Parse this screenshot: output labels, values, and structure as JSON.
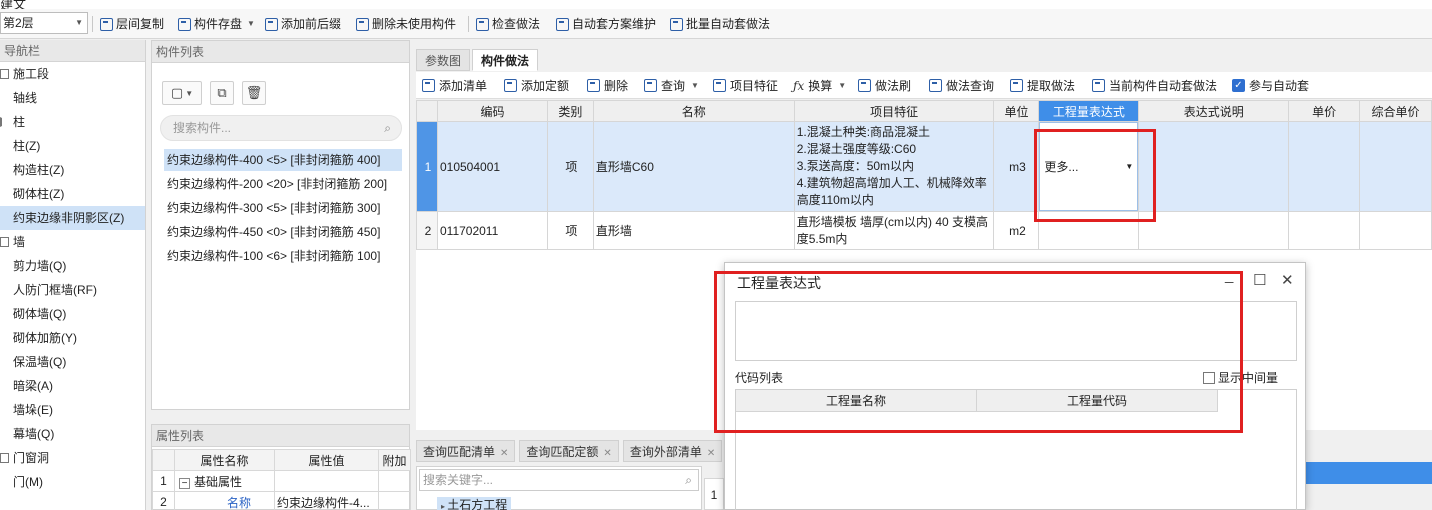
{
  "top_strip_text": "建文",
  "toolbar": {
    "floor": "第2层",
    "buttons": [
      "层间复制",
      "构件存盘",
      "添加前后缀",
      "删除未使用构件",
      "检查做法",
      "自动套方案维护",
      "批量自动套做法"
    ]
  },
  "nav": {
    "title": "导航栏",
    "items": [
      {
        "label": "施工段",
        "group": true
      },
      {
        "label": "轴线",
        "group": true
      },
      {
        "label": "柱",
        "group": true
      },
      {
        "label": "柱(Z)",
        "group": false
      },
      {
        "label": "构造柱(Z)",
        "group": false
      },
      {
        "label": "砌体柱(Z)",
        "group": false
      },
      {
        "label": "约束边缘非阴影区(Z)",
        "group": false,
        "selected": true
      },
      {
        "label": "墙",
        "group": true
      },
      {
        "label": "剪力墙(Q)",
        "group": false
      },
      {
        "label": "人防门框墙(RF)",
        "group": false
      },
      {
        "label": "砌体墙(Q)",
        "group": false
      },
      {
        "label": "砌体加筋(Y)",
        "group": false
      },
      {
        "label": "保温墙(Q)",
        "group": false
      },
      {
        "label": "暗梁(A)",
        "group": false
      },
      {
        "label": "墙垛(E)",
        "group": false
      },
      {
        "label": "幕墙(Q)",
        "group": false
      },
      {
        "label": "门窗洞",
        "group": true
      },
      {
        "label": "门(M)",
        "group": false
      }
    ]
  },
  "component_list": {
    "title": "构件列表",
    "search_placeholder": "搜索构件...",
    "items": [
      "约束边缘构件-400 <5> [非封闭箍筋 400]",
      "约束边缘构件-200 <20> [非封闭箍筋 200]",
      "约束边缘构件-300 <5> [非封闭箍筋 300]",
      "约束边缘构件-450 <0> [非封闭箍筋 450]",
      "约束边缘构件-100 <6> [非封闭箍筋 100]"
    ]
  },
  "property_list": {
    "title": "属性列表",
    "headers": [
      "属性名称",
      "属性值",
      "附加"
    ],
    "rows": [
      {
        "idx": "1",
        "name": "基础属性",
        "value": "",
        "toggle": "−"
      },
      {
        "idx": "2",
        "name": "名称",
        "value": "约束边缘构件-4..."
      }
    ]
  },
  "tabs": [
    "参数图",
    "构件做法"
  ],
  "method_toolbar": {
    "buttons": [
      "添加清单",
      "添加定额",
      "删除",
      "查询",
      "项目特征",
      "换算",
      "做法刷",
      "做法查询",
      "提取做法",
      "当前构件自动套做法"
    ],
    "checkbox_label": "参与自动套"
  },
  "grid": {
    "headers": [
      "编码",
      "类别",
      "名称",
      "项目特征",
      "单位",
      "工程量表达式",
      "表达式说明",
      "单价",
      "综合单价"
    ],
    "rows": [
      {
        "idx": "1",
        "code": "010504001",
        "type": "项",
        "name": "直形墙C60",
        "features": [
          "1.混凝土种类:商品混凝土",
          "2.混凝土强度等级:C60",
          "3.泵送高度：50m以内",
          "4.建筑物超高增加人工、机械降效率高度110m以内"
        ],
        "unit": "m3",
        "expression": "更多..."
      },
      {
        "idx": "2",
        "code": "011702011",
        "type": "项",
        "name": "直形墙",
        "features": [
          "直形墙模板 墙厚(cm以内) 40 支模高度5.5m内"
        ],
        "unit": "m2",
        "expression": ""
      }
    ]
  },
  "lower_tabs": [
    "查询匹配清单",
    "查询匹配定额",
    "查询外部清单"
  ],
  "lower_search_placeholder": "搜索关键字...",
  "lower_tree_item": "土石方工程",
  "lower_row_idx": "1",
  "dialog": {
    "title": "工程量表达式",
    "code_list_label": "代码列表",
    "show_mid_label": "显示中间量",
    "columns": [
      "工程量名称",
      "工程量代码"
    ]
  }
}
